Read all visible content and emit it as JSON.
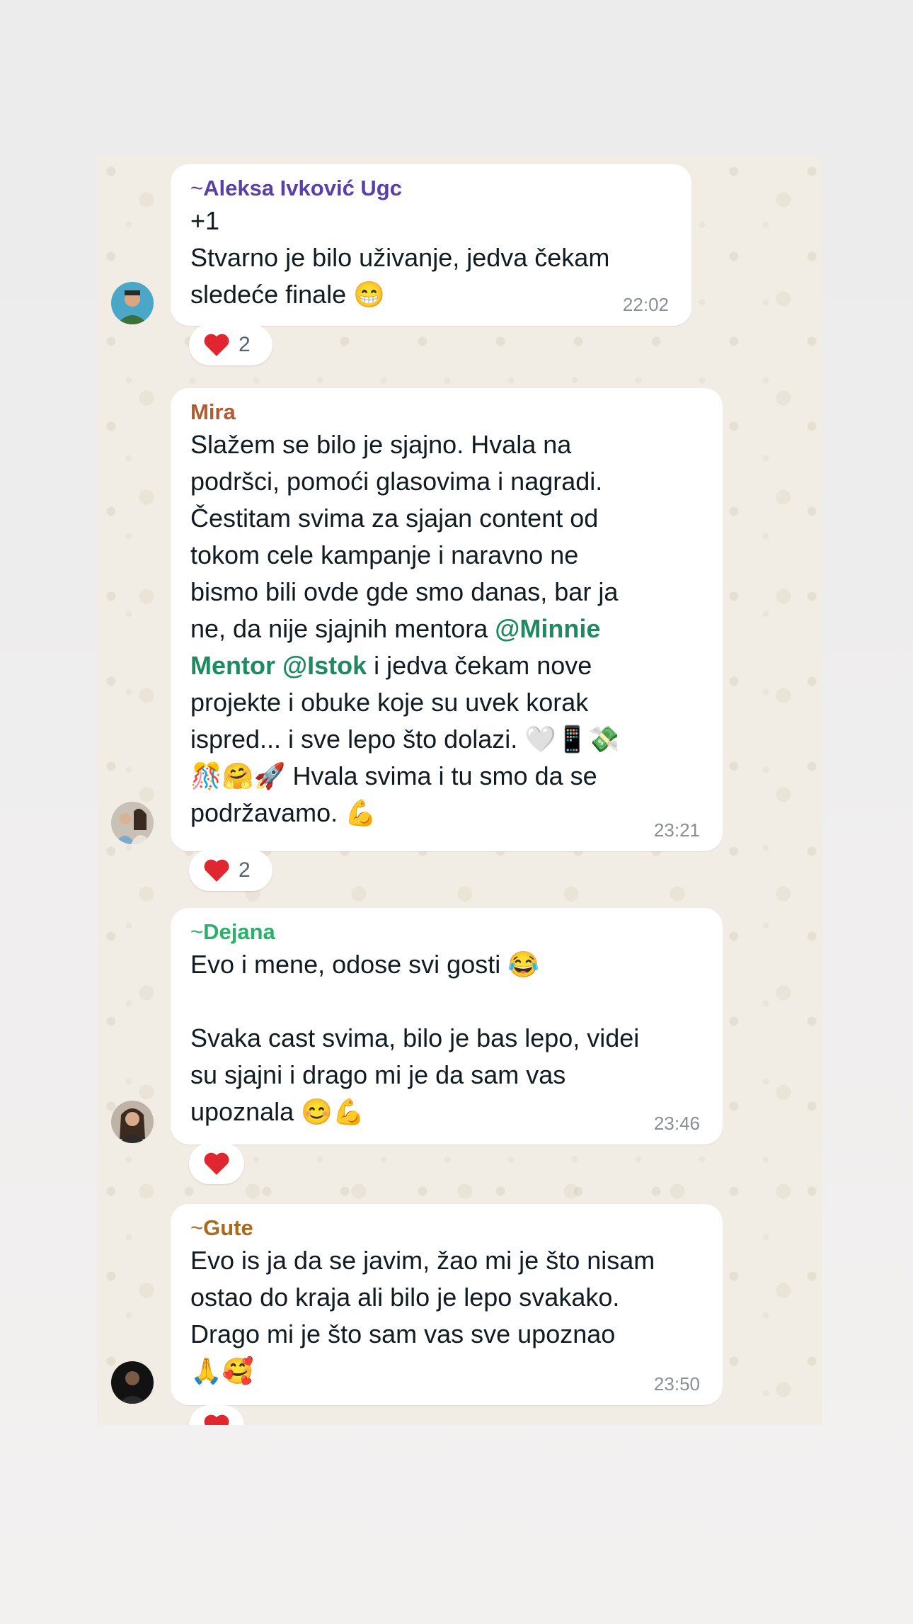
{
  "messages": [
    {
      "sender": "Aleksa Ivković Ugc",
      "sender_prefix": "~",
      "sender_color": "#5a3fa8",
      "lines": [
        "+1",
        "Stvarno je bilo uživanje, jedva čekam",
        "sledeće finale 😁"
      ],
      "time": "22:02",
      "reaction": {
        "emoji": "heart",
        "count": "2"
      }
    },
    {
      "sender": "Mira",
      "sender_prefix": "",
      "sender_color": "#b45a2f",
      "lines_before_mention": "Slažem se bilo je sjajno. Hvala na\npodršci, pomoći glasovima i nagradi.\nČestitam svima za sjajan content od\ntokom cele kampanje i naravno ne\nbismo bili ovde gde smo danas, bar ja\nne, da nije sjajnih mentora ",
      "mention_1": "@Minnie\nMentor",
      "mention_2": "@Istok",
      "lines_after_mention": " i jedva čekam nove\nprojekte i obuke koje su uvek korak\nispred... i sve lepo što dolazi. 🤍📱💸\n🎊🤗🚀 Hvala svima i tu smo da se\npodržavamo. 💪",
      "time": "23:21",
      "reaction": {
        "emoji": "heart",
        "count": "2"
      }
    },
    {
      "sender": "Dejana",
      "sender_prefix": "~",
      "sender_color": "#2bb06a",
      "text": "Evo i mene, odose svi gosti 😂\n\nSvaka cast svima, bilo je bas lepo, videi\nsu sjajni i drago mi je da sam vas\nupoznala 😊💪",
      "time": "23:46",
      "reaction": {
        "emoji": "heart",
        "count": ""
      }
    },
    {
      "sender": "Gute",
      "sender_prefix": "~",
      "sender_color": "#a86a1c",
      "text": "Evo is ja da se javim, žao mi je što nisam\nostao do kraja ali bilo je lepo svakako.\nDrago mi je što sam vas sve upoznao\n🙏🥰",
      "time": "23:50",
      "reaction": {
        "emoji": "heart",
        "count": ""
      }
    }
  ],
  "colors": {
    "mention": "#1d8a5f",
    "heart": "#e0262e",
    "bubble": "#ffffff",
    "chat_bg": "#f2ede4"
  }
}
